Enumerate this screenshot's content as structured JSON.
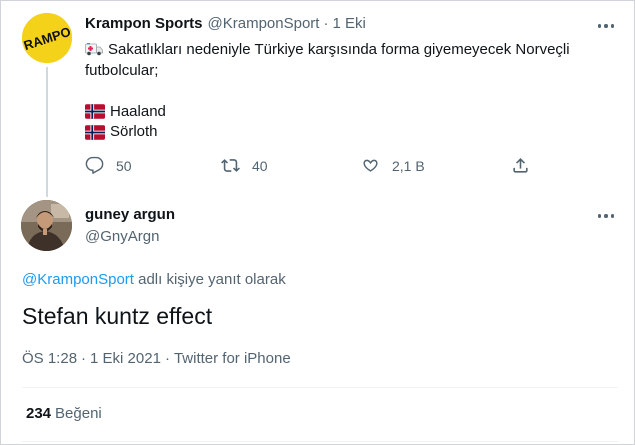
{
  "original_tweet": {
    "author_name": "Krampon Sports",
    "author_handle": "@KramponSport",
    "separator": "·",
    "time": "1 Eki",
    "avatar_logo_text": "KRAMPON",
    "text_line1": "Sakatlıkları nedeniyle Türkiye karşısında forma giyemeyecek Norveçli futbolcular;",
    "players": [
      "Haaland",
      "Sörloth"
    ],
    "icons": [
      "ambulance-icon",
      "norway-flag-icon"
    ],
    "actions": {
      "replies": "50",
      "retweets": "40",
      "likes": "2,1 B"
    }
  },
  "reply_tweet": {
    "author_name": "guney argun",
    "author_handle": "@GnyArgn",
    "replying_mention": "@KramponSport",
    "replying_suffix": " adlı kişiye yanıt olarak",
    "text": "Stefan kuntz effect",
    "time": "ÖS 1:28",
    "separator": "·",
    "date": "1 Eki 2021",
    "source": "Twitter for iPhone",
    "like_count": "234",
    "like_label": "Beğeni"
  },
  "colors": {
    "link": "#1d9bf0",
    "secondary_text": "#536471",
    "primary_text": "#0f1419",
    "avatar_yellow": "#f5d21a",
    "thread_line": "#cfd9de"
  }
}
